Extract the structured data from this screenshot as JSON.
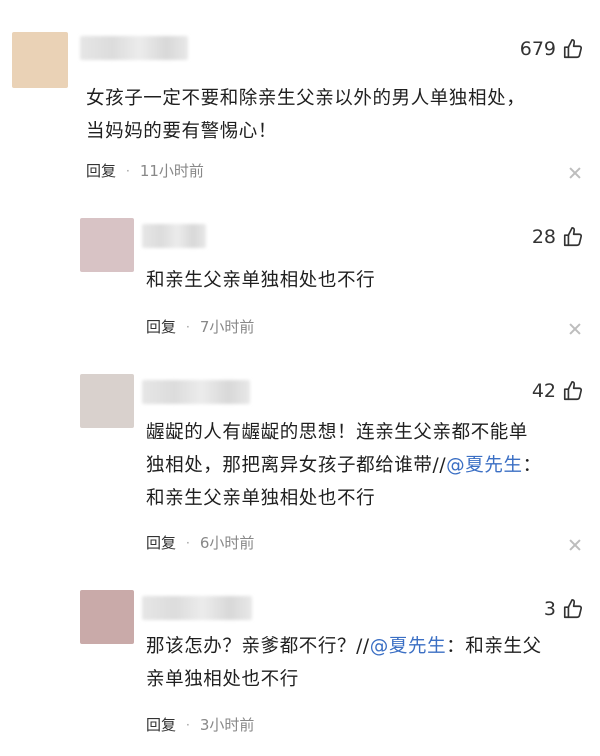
{
  "colors": {
    "avatar_1": "#ead2b6",
    "avatar_2": "#d8c3c5",
    "avatar_3": "#d9d1cd",
    "avatar_4": "#c9aaa9",
    "mention": "#3b6fc4"
  },
  "icons": {
    "like": "thumb-up-icon",
    "dismiss": "close-icon"
  },
  "comments": [
    {
      "likes": "679",
      "lines": [
        "女孩子一定不要和除亲生父亲以外的男人单独相处，",
        "当妈妈的要有警惕心！"
      ],
      "reply_label": "回复",
      "dot": "·",
      "time": "11小时前"
    },
    {
      "likes": "28",
      "lines": [
        "和亲生父亲单独相处也不行"
      ],
      "reply_label": "回复",
      "dot": "·",
      "time": "7小时前"
    },
    {
      "likes": "42",
      "line1": "龌龊的人有龌龊的思想！连亲生父亲都不能单",
      "line2_pre": "独相处，那把离异女孩子都给谁带//",
      "line2_mention": "@夏先生",
      "line2_post": "：",
      "line3": "和亲生父亲单独相处也不行",
      "reply_label": "回复",
      "dot": "·",
      "time": "6小时前"
    },
    {
      "likes": "3",
      "line1_pre": "那该怎办？亲爹都不行？//",
      "line1_mention": "@夏先生",
      "line1_post": "：和亲生父",
      "line2": "亲单独相处也不行",
      "reply_label": "回复",
      "dot": "·",
      "time": "3小时前"
    }
  ]
}
